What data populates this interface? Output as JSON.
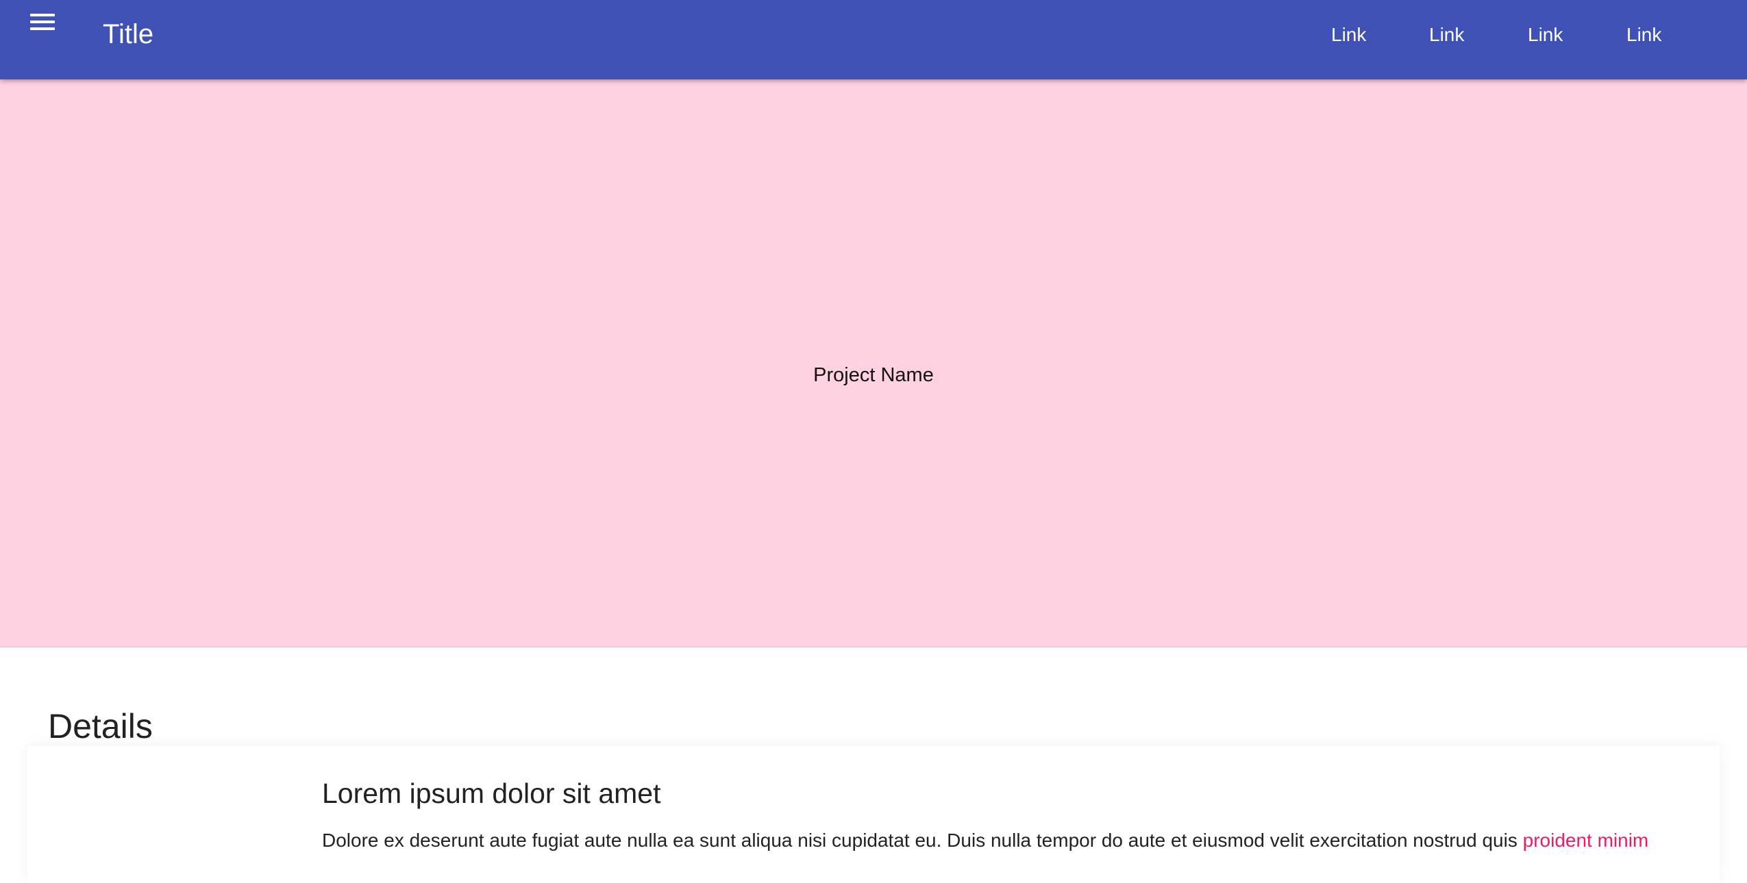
{
  "header": {
    "title": "Title",
    "menu_icon": "hamburger-menu-icon",
    "links": [
      "Link",
      "Link",
      "Link",
      "Link"
    ],
    "background_color": "#3f51b5"
  },
  "hero": {
    "project_name": "Project Name",
    "background_color": "#ffd1e1"
  },
  "details": {
    "heading": "Details",
    "article": {
      "title": "Lorem ipsum dolor sit amet",
      "text": "Dolore ex deserunt aute fugiat aute nulla ea sunt aliqua nisi cupidatat eu. Duis nulla tempor do aute et eiusmod velit exercitation nostrud quis ",
      "link_text": "proident minim",
      "link_color": "#e91e63"
    }
  }
}
